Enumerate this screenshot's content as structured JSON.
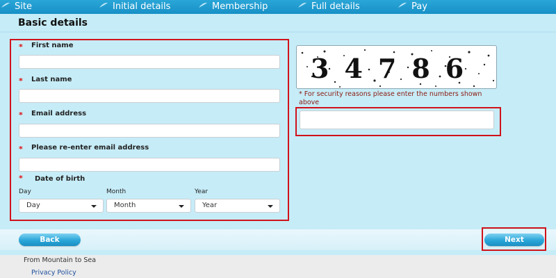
{
  "nav": {
    "steps": [
      "Site",
      "Initial details",
      "Membership",
      "Full details",
      "Pay"
    ]
  },
  "page": {
    "title": "Basic details"
  },
  "form": {
    "required_marker": "*",
    "first_name_label": "First name",
    "last_name_label": "Last name",
    "email_label": "Email address",
    "email_confirm_label": "Please re-enter email address",
    "dob_label": "Date of birth",
    "dob": {
      "day_label": "Day",
      "month_label": "Month",
      "year_label": "Year",
      "day_value": "Day",
      "month_value": "Month",
      "year_value": "Year"
    }
  },
  "captcha": {
    "code": "34786",
    "note": "* For security reasons please enter the numbers shown above"
  },
  "buttons": {
    "back": "Back",
    "next": "Next"
  },
  "footer": {
    "text": "From Mountain to Sea",
    "link": "Privacy Policy"
  },
  "colors": {
    "nav_blue": "#1f9bd1",
    "required_red": "#e01010",
    "highlight_red": "#d0121a",
    "page_bg": "#c6ecf7",
    "link": "#1e4f9c"
  }
}
